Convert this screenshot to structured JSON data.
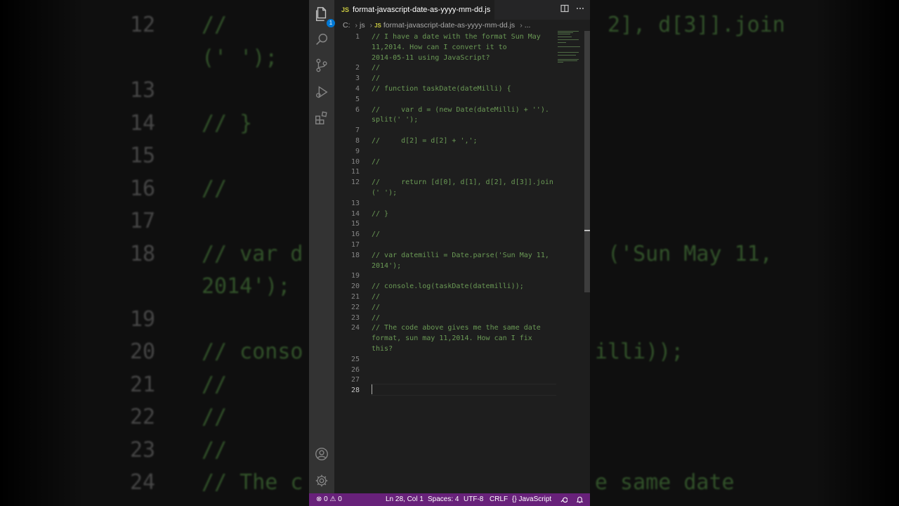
{
  "background": {
    "rows": [
      {
        "num": "12",
        "code": "//        r                     2], d[3]].join"
      },
      {
        "num": "",
        "code": "(' ');"
      },
      {
        "num": "13",
        "code": ""
      },
      {
        "num": "14",
        "code": "// }"
      },
      {
        "num": "15",
        "code": ""
      },
      {
        "num": "16",
        "code": "//"
      },
      {
        "num": "17",
        "code": ""
      },
      {
        "num": "18",
        "code": "// var d                        ('Sun May 11,"
      },
      {
        "num": "",
        "code": "2014');"
      },
      {
        "num": "19",
        "code": ""
      },
      {
        "num": "20",
        "code": "// conso                       illi));"
      },
      {
        "num": "21",
        "code": "//"
      },
      {
        "num": "22",
        "code": "//"
      },
      {
        "num": "23",
        "code": "//"
      },
      {
        "num": "24",
        "code": "// The c                       e same date"
      }
    ]
  },
  "tab": {
    "lang_badge": "JS",
    "title": "format-javascript-date-as-yyyy-mm-dd.js"
  },
  "activity": {
    "explorer_badge": "1"
  },
  "breadcrumb": {
    "drive": "C:",
    "folder": "js",
    "lang_badge": "JS",
    "file": "format-javascript-date-as-yyyy-mm-dd.js",
    "more": "..."
  },
  "editor": {
    "rows": [
      {
        "num": "1",
        "code": "// I have a date with the format Sun May"
      },
      {
        "num": "",
        "code": "11,2014. How can I convert it to"
      },
      {
        "num": "",
        "code": "2014-05-11 using JavaScript?"
      },
      {
        "num": "2",
        "code": "//"
      },
      {
        "num": "3",
        "code": "//"
      },
      {
        "num": "4",
        "code": "// function taskDate(dateMilli) {"
      },
      {
        "num": "5",
        "code": ""
      },
      {
        "num": "6",
        "code": "//     var d = (new Date(dateMilli) + '')."
      },
      {
        "num": "",
        "code": "split(' ');"
      },
      {
        "num": "7",
        "code": ""
      },
      {
        "num": "8",
        "code": "//     d[2] = d[2] + ',';"
      },
      {
        "num": "9",
        "code": ""
      },
      {
        "num": "10",
        "code": "//"
      },
      {
        "num": "11",
        "code": ""
      },
      {
        "num": "12",
        "code": "//     return [d[0], d[1], d[2], d[3]].join"
      },
      {
        "num": "",
        "code": "(' ');"
      },
      {
        "num": "13",
        "code": ""
      },
      {
        "num": "14",
        "code": "// }"
      },
      {
        "num": "15",
        "code": ""
      },
      {
        "num": "16",
        "code": "//"
      },
      {
        "num": "17",
        "code": ""
      },
      {
        "num": "18",
        "code": "// var datemilli = Date.parse('Sun May 11,"
      },
      {
        "num": "",
        "code": "2014');"
      },
      {
        "num": "19",
        "code": ""
      },
      {
        "num": "20",
        "code": "// console.log(taskDate(datemilli));"
      },
      {
        "num": "21",
        "code": "//"
      },
      {
        "num": "22",
        "code": "//"
      },
      {
        "num": "23",
        "code": "//"
      },
      {
        "num": "24",
        "code": "// The code above gives me the same date"
      },
      {
        "num": "",
        "code": "format, sun may 11,2014. How can I fix"
      },
      {
        "num": "",
        "code": "this?"
      },
      {
        "num": "25",
        "code": ""
      },
      {
        "num": "26",
        "code": ""
      },
      {
        "num": "27",
        "code": ""
      },
      {
        "num": "28",
        "code": ""
      }
    ]
  },
  "statusbar": {
    "errors": "0",
    "warnings": "0",
    "position": "Ln 28, Col 1",
    "spaces": "Spaces: 4",
    "encoding": "UTF-8",
    "eol": "CRLF",
    "language": "JavaScript"
  },
  "colors": {
    "comment": "#6a9955",
    "statusbar": "#68217a",
    "editor_bg": "#1e1e1e"
  }
}
